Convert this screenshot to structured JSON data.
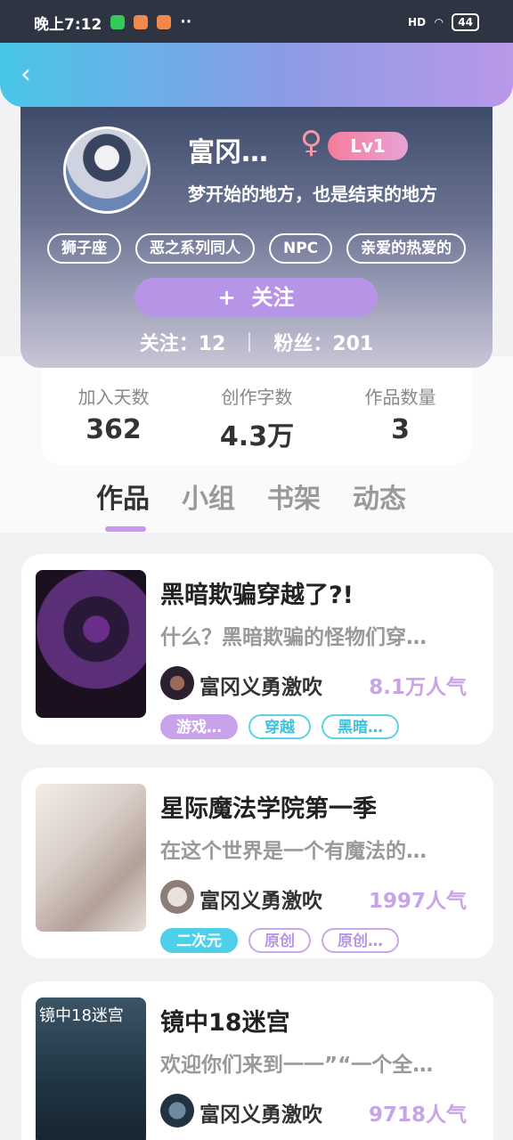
{
  "status_bar": {
    "time": "晚上7:12",
    "battery": "44",
    "network": "HD"
  },
  "profile": {
    "username": "富冈…",
    "gender_symbol": "♀",
    "level": "Lv1",
    "signature": "梦开始的地方，也是结束的地方",
    "tags": [
      "狮子座",
      "恶之系列同人",
      "NPC",
      "亲爱的热爱的"
    ],
    "follow_label": "关注",
    "follow_plus": "+",
    "following_label": "关注：12",
    "followers_label": "粉丝：201"
  },
  "stats": [
    {
      "label": "加入天数",
      "value": "362"
    },
    {
      "label": "创作字数",
      "value": "4.3万"
    },
    {
      "label": "作品数量",
      "value": "3"
    }
  ],
  "tabs": [
    "作品",
    "小组",
    "书架",
    "动态"
  ],
  "works": [
    {
      "title": "黑暗欺骗穿越了?!",
      "desc": "什么？黑暗欺骗的怪物们穿…",
      "author": "富冈义勇激吹",
      "popularity": "8.1万人气",
      "tags": [
        "游戏…",
        "穿越",
        "黑暗…"
      ],
      "cover_text": ""
    },
    {
      "title": "星际魔法学院第一季",
      "desc": "在这个世界是一个有魔法的…",
      "author": "富冈义勇激吹",
      "popularity": "1997人气",
      "tags": [
        "二次元",
        "原创",
        "原创…"
      ],
      "cover_text": ""
    },
    {
      "title": "镜中18迷宫",
      "desc": "欢迎你们来到一一”“一个全…",
      "author": "富冈义勇激吹",
      "popularity": "9718人气",
      "tags": [],
      "cover_text": "镜中18迷宫"
    }
  ],
  "colors": {
    "accent": "#b795e6",
    "nav_start": "#47c6e9",
    "nav_end": "#b998e8"
  }
}
